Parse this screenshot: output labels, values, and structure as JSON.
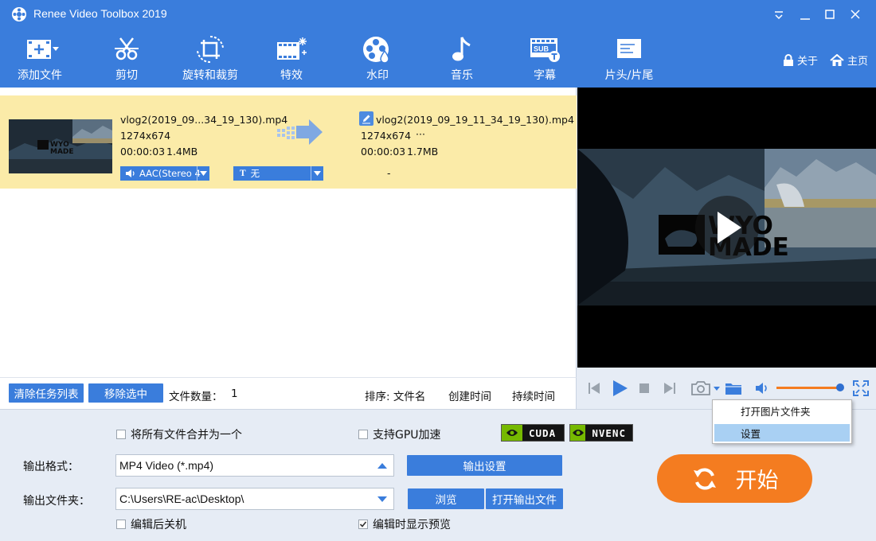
{
  "window": {
    "title": "Renee Video Toolbox 2019"
  },
  "toolbar": {
    "tools": [
      {
        "id": "add-file",
        "label": "添加文件",
        "icon": "film-plus-icon"
      },
      {
        "id": "cut",
        "label": "剪切",
        "icon": "scissors-icon"
      },
      {
        "id": "rotate-crop",
        "label": "旋转和裁剪",
        "icon": "crop-rotate-icon"
      },
      {
        "id": "effects",
        "label": "特效",
        "icon": "film-sparkle-icon"
      },
      {
        "id": "watermark",
        "label": "水印",
        "icon": "film-reel-drop-icon"
      },
      {
        "id": "music",
        "label": "音乐",
        "icon": "music-note-icon"
      },
      {
        "id": "subtitle",
        "label": "字幕",
        "icon": "subtitle-icon"
      },
      {
        "id": "intro-outro",
        "label": "片头/片尾",
        "icon": "title-card-icon"
      }
    ],
    "about_label": "关于",
    "home_label": "主页"
  },
  "file": {
    "source_name": "vlog2(2019_09...34_19_130).mp4",
    "source_resolution": "1274x674",
    "source_duration": "00:00:03",
    "source_size": "1.4MB",
    "output_name": "vlog2(2019_09_19_11_34_19_130).mp4",
    "output_resolution": "1274x674",
    "output_more": "···",
    "output_duration": "00:00:03",
    "output_size": "1.7MB",
    "audio_track": "AAC(Stereo 4",
    "subtitle_track": "无",
    "subtitle_placeholder": "-",
    "thumbnail_text": "WYO MADE"
  },
  "list_footer": {
    "clear_label": "清除任务列表",
    "remove_label": "移除选中",
    "count_label": "文件数量：",
    "count_value": "1",
    "sort_label": "排序: 文件名",
    "sort_created": "创建时间",
    "sort_duration": "持续时间"
  },
  "preview": {
    "watermark_line1": "WYO",
    "watermark_line2": "MADE",
    "volume_level": 1.0
  },
  "context_menu": {
    "items": [
      {
        "label": "打开图片文件夹"
      },
      {
        "label": "设置"
      }
    ],
    "highlighted_index": 1
  },
  "settings": {
    "merge_label": "将所有文件合并为一个",
    "merge_checked": false,
    "gpu_label": "支持GPU加速",
    "gpu_checked": false,
    "cuda_label": "CUDA",
    "nvenc_label": "NVENC",
    "format_label": "输出格式：",
    "format_value": "MP4 Video (*.mp4)",
    "output_settings_label": "输出设置",
    "folder_label": "输出文件夹：",
    "folder_value": "C:\\Users\\RE-ac\\Desktop\\",
    "browse_label": "浏览",
    "open_folder_label": "打开输出文件",
    "shutdown_label": "编辑后关机",
    "shutdown_checked": false,
    "preview_label": "编辑时显示预览",
    "preview_checked": true,
    "start_label": "开始"
  },
  "colors": {
    "brand_blue": "#3a7ddc",
    "accent_orange": "#f47c20",
    "selected_row": "#fbeba8",
    "nvidia_green": "#76b900"
  }
}
